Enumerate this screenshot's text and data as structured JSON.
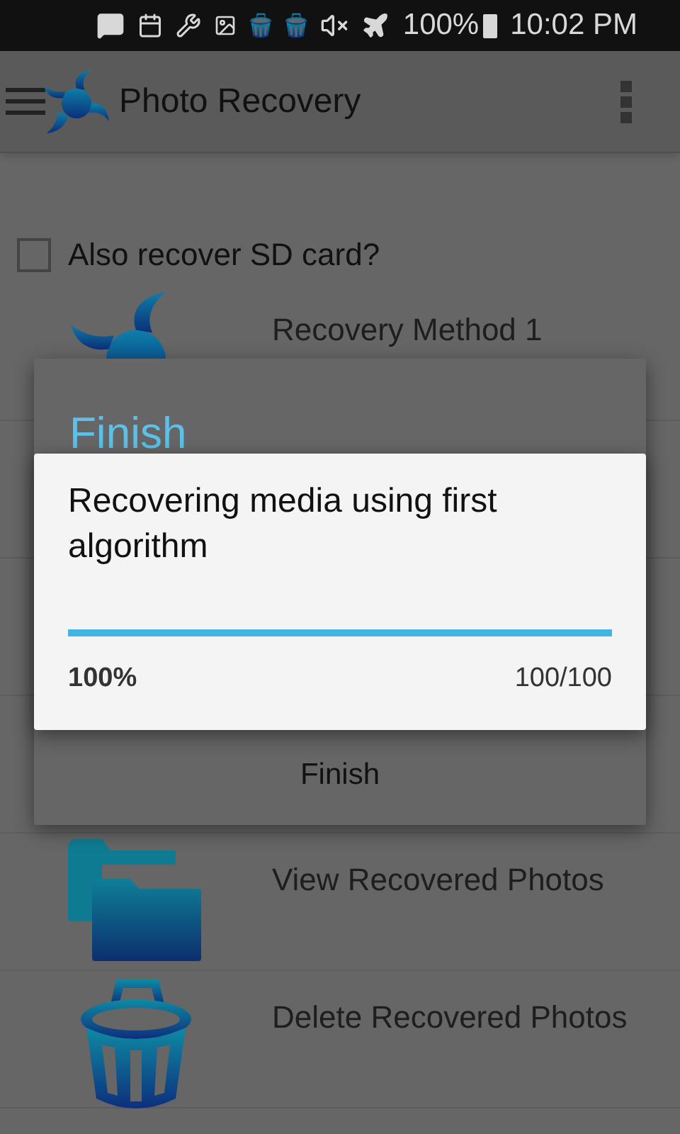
{
  "status_bar": {
    "battery": "100%",
    "time": "10:02 PM"
  },
  "app_bar": {
    "title": "Photo Recovery"
  },
  "sd_option": {
    "label": "Also recover SD card?",
    "checked": false
  },
  "menu": [
    {
      "kind": "swirl",
      "label": "Recovery Method 1"
    },
    {
      "kind": "folder",
      "label": "View Recovered Photos"
    },
    {
      "kind": "trash",
      "label": "Delete Recovered Photos"
    }
  ],
  "back_dialog": {
    "title": "Finish",
    "button": "Finish"
  },
  "progress_dialog": {
    "message": "Recovering media using first algorithm",
    "level": 1,
    "percent": "100%",
    "count": "100/100"
  }
}
